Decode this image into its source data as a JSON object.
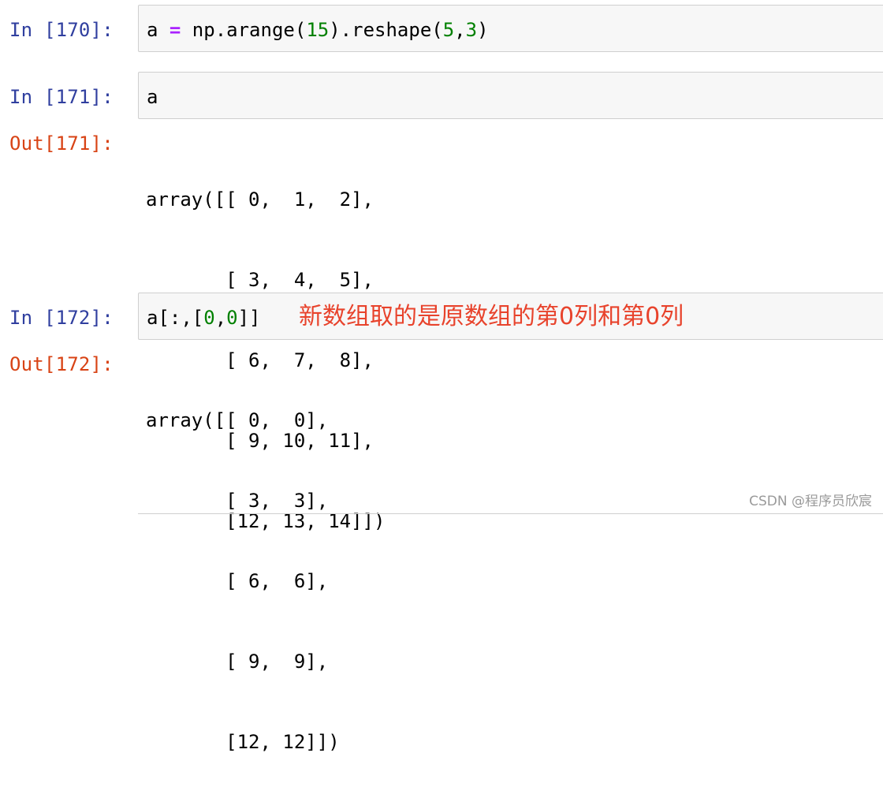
{
  "cells": [
    {
      "prompt": "In [170]:",
      "code_parts": {
        "p1": "a ",
        "op": "=",
        "p2": " np.arange(",
        "n1": "15",
        "p3": ").reshape(",
        "n2": "5",
        "p4": ",",
        "n3": "3",
        "p5": ")"
      }
    },
    {
      "prompt": "In [171]:",
      "code": "a",
      "out_prompt": "Out[171]:",
      "output_lines": [
        "array([[ 0,  1,  2],",
        "       [ 3,  4,  5],",
        "       [ 6,  7,  8],",
        "       [ 9, 10, 11],",
        "       [12, 13, 14]])"
      ]
    },
    {
      "prompt": "In [172]:",
      "code_parts": {
        "p1": "a[:,[",
        "n1": "0",
        "p2": ",",
        "n2": "0",
        "p3": "]]"
      },
      "annotation": "新数组取的是原数组的第0列和第0列",
      "out_prompt": "Out[172]:",
      "output_lines": [
        "array([[ 0,  0],",
        "       [ 3,  3],",
        "       [ 6,  6],",
        "       [ 9,  9],",
        "       [12, 12]])"
      ]
    }
  ],
  "watermark": "CSDN @程序员欣宸",
  "colors": {
    "in_prompt": "#303f9f",
    "out_prompt": "#d84315",
    "operator": "#aa22ff",
    "number": "#008000",
    "annotation": "#e8432c"
  }
}
